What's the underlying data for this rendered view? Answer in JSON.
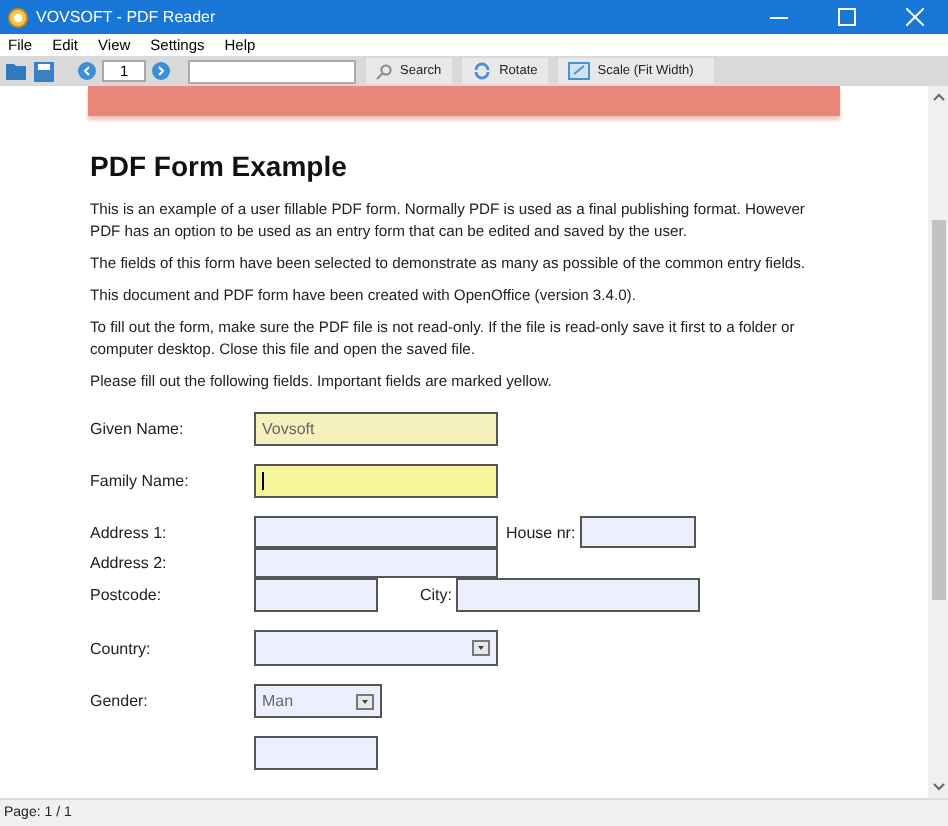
{
  "window": {
    "title": "VOVSOFT - PDF Reader"
  },
  "menu": [
    "File",
    "Edit",
    "View",
    "Settings",
    "Help"
  ],
  "toolbar": {
    "page": "1",
    "buttons": [
      {
        "kind": "search",
        "label": "Search"
      },
      {
        "kind": "rotate",
        "label": "Rotate"
      },
      {
        "kind": "scale",
        "label": "Scale (Fit Width)"
      }
    ]
  },
  "document": {
    "heading": "PDF Form Example",
    "paragraphs": [
      "This is an example of a user fillable PDF form. Normally PDF is used as a final publishing format. However PDF has an option to be used as an entry form that can be edited and saved by the user.",
      "The fields of this form have been selected to demonstrate as many as possible of the common entry fields.",
      "This document and PDF form have been created with OpenOffice (version 3.4.0).",
      "To fill out the form, make sure the PDF file is not read-only. If the file is read-only save it first to a folder or computer desktop. Close this file and open the saved file.",
      "Please fill out the following fields. Important fields are marked yellow."
    ],
    "rows": [
      {
        "fields": [
          {
            "label": "Given Name:",
            "kind": "text",
            "value": "Vovsoft",
            "required": true,
            "focused": false
          }
        ]
      },
      {
        "fields": [
          {
            "label": "Family Name:",
            "kind": "text",
            "required": true,
            "focused": true
          }
        ]
      },
      {
        "fields": [
          {
            "label": "Address 1:",
            "kind": "text",
            "required": false,
            "focused": false
          },
          {
            "label": "House nr:",
            "kind": "text",
            "required": false,
            "focused": false
          }
        ]
      },
      {
        "fields": [
          {
            "label": "Address 2:",
            "kind": "text",
            "required": false,
            "focused": false
          }
        ]
      },
      {
        "fields": [
          {
            "label": "Postcode:",
            "kind": "text",
            "required": false,
            "focused": false
          },
          {
            "label": "City:",
            "kind": "text",
            "required": false,
            "focused": false
          }
        ]
      },
      {
        "fields": [
          {
            "label": "Country:",
            "kind": "dropdown",
            "required": false,
            "focused": false
          }
        ]
      },
      {
        "fields": [
          {
            "label": "Gender:",
            "kind": "dropdown",
            "value": "Man",
            "required": false,
            "focused": false
          }
        ]
      }
    ]
  },
  "status_bar": {
    "text": "Page: 1 / 1"
  }
}
